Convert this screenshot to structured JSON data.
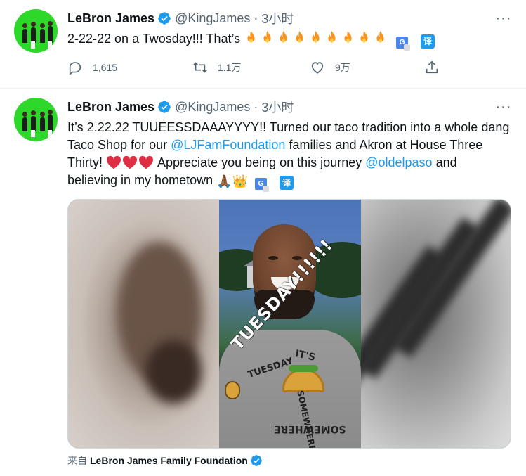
{
  "tweets": [
    {
      "author": {
        "name": "LeBron James",
        "handle": "@KingJames"
      },
      "time": "3小时",
      "more": "···",
      "text_prefix": "2-22-22 on a Twosday!!! That’s ",
      "emojis": [
        "fire",
        "fire",
        "fire",
        "fire",
        "fire",
        "fire",
        "fire",
        "fire",
        "fire"
      ],
      "translate_badge": "译",
      "actions": {
        "reply": {
          "icon": "reply-icon",
          "count": "1,615"
        },
        "retweet": {
          "icon": "retweet-icon",
          "count": "1.1万"
        },
        "like": {
          "icon": "heart-icon",
          "count": "9万"
        },
        "share": {
          "icon": "share-icon",
          "count": ""
        }
      }
    },
    {
      "author": {
        "name": "LeBron James",
        "handle": "@KingJames"
      },
      "time": "3小时",
      "more": "···",
      "text": {
        "part1": "It’s 2.22.22 TUUEESSDAAAYYYY!! Turned our taco tradition into a whole dang Taco Shop for our ",
        "mention1": "@LJFamFoundation",
        "part2": " families and Akron at House Three Thirty! ",
        "emojis_hearts": [
          "red-heart",
          "red-heart",
          "red-heart"
        ],
        "part3": " Appreciate you being on this journey ",
        "mention2": "@oldelpaso",
        "part4": " and believing in my hometown ",
        "emojis_end": [
          "🙏🏾",
          "👑"
        ]
      },
      "translate_badge": "译",
      "media": {
        "sticker_text": "TUESDAY!!!!!!",
        "shirt_lines": [
          "IT'S",
          "TUESDAY",
          "SOMEWHERE",
          "SOMEWHERE"
        ]
      },
      "source": {
        "prefix": "来自",
        "name": "LeBron James Family Foundation"
      }
    }
  ],
  "colors": {
    "accent": "#1d9bf0",
    "text": "#0f1419",
    "secondary": "#536471",
    "avatar_bg": "#2ed82a",
    "fire": "#f7931e",
    "heart": "#dd2e44"
  }
}
